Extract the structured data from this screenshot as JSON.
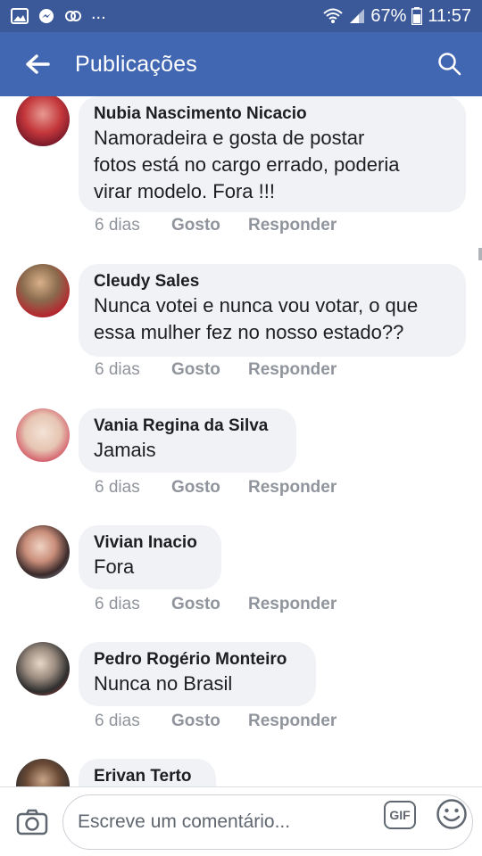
{
  "status_bar": {
    "battery": "67%",
    "time": "11:57",
    "more": "..."
  },
  "app_bar": {
    "title": "Publicações",
    "back_icon": "arrow-left-icon",
    "search_icon": "search-icon"
  },
  "comments": [
    {
      "author": "Nubia Nascimento Nicacio",
      "lines": [
        "Namoradeira e gosta de   postar",
        "fotos está no cargo errado, poderia",
        "virar modelo. Fora !!!"
      ],
      "time": "6 dias",
      "like": "Gosto",
      "reply": "Responder"
    },
    {
      "author": "Cleudy Sales",
      "lines": [
        "Nunca votei e nunca vou votar, o que",
        "essa mulher fez no nosso estado??"
      ],
      "time": "6 dias",
      "like": "Gosto",
      "reply": "Responder"
    },
    {
      "author": "Vania Regina da Silva",
      "lines": [
        "Jamais"
      ],
      "time": "6 dias",
      "like": "Gosto",
      "reply": "Responder"
    },
    {
      "author": "Vivian Inacio",
      "lines": [
        "Fora"
      ],
      "time": "6 dias",
      "like": "Gosto",
      "reply": "Responder"
    },
    {
      "author": "Pedro Rogério Monteiro",
      "lines": [
        "Nunca no Brasil"
      ],
      "time": "6 dias",
      "like": "Gosto",
      "reply": "Responder"
    },
    {
      "author": "Erivan Terto",
      "lines": [],
      "time": "",
      "like": "",
      "reply": ""
    }
  ],
  "composer": {
    "placeholder": "Escreve um comentário...",
    "gif_label": "GIF",
    "camera_icon": "camera-icon",
    "emoji_icon": "emoji-icon"
  },
  "colors": {
    "status_bar": "#3b5998",
    "app_bar": "#4267b2",
    "bubble": "#f0f2f5",
    "meta": "#90949c"
  }
}
